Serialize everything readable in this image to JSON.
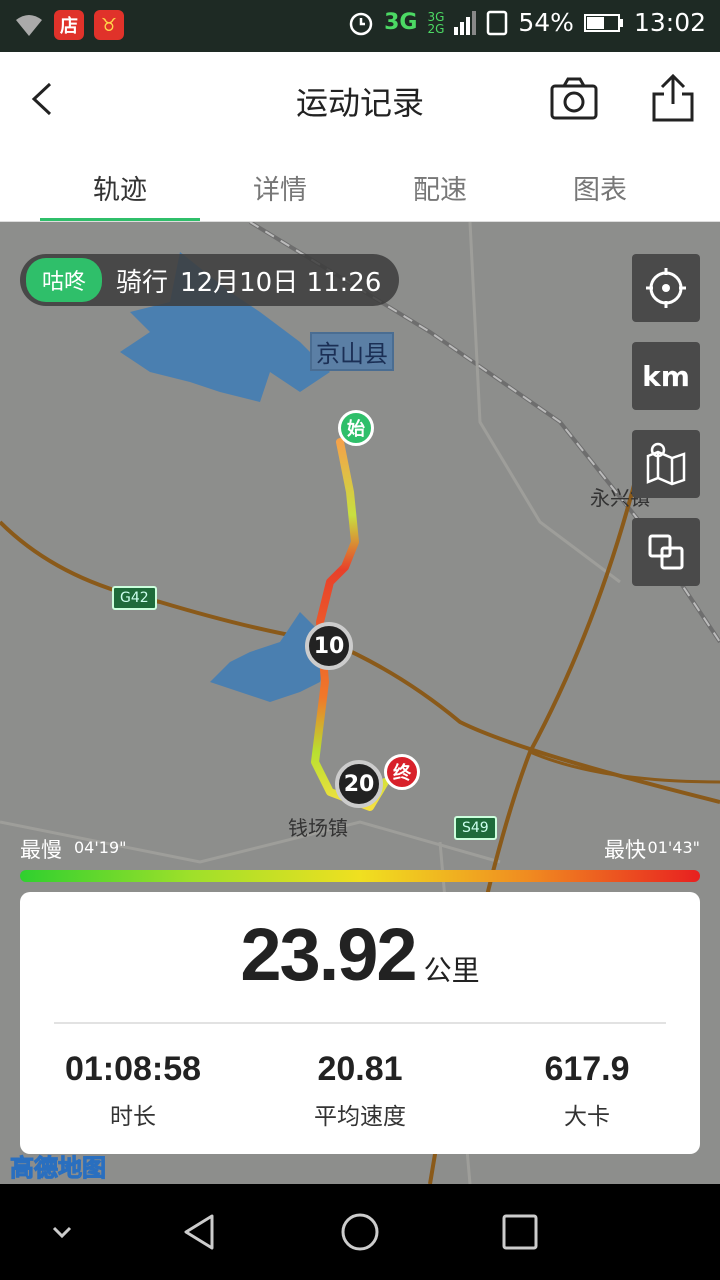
{
  "status_bar": {
    "network_main": "3G",
    "network_sub_top": "3G",
    "network_sub_bottom": "2G",
    "battery": "54%",
    "time": "13:02",
    "icons": [
      "wifi-icon",
      "shop-app-icon",
      "bull-app-icon",
      "alarm-icon",
      "signal-icon",
      "sim-icon",
      "battery-icon"
    ]
  },
  "header": {
    "title": "运动记录",
    "back_icon": "chevron-left-icon",
    "camera_icon": "camera-icon",
    "share_icon": "share-icon"
  },
  "tabs": [
    {
      "label": "轨迹",
      "active": true
    },
    {
      "label": "详情",
      "active": false
    },
    {
      "label": "配速",
      "active": false
    },
    {
      "label": "图表",
      "active": false
    }
  ],
  "map": {
    "tag": "咕咚",
    "sport": "骑行",
    "datetime": "12月10日 11:26",
    "county": "京山县",
    "town_yongxing": "永兴镇",
    "town_qianchang": "钱场镇",
    "road_g42": "G42",
    "road_s49": "S49",
    "start_label": "始",
    "end_label": "终",
    "km_markers": [
      "10",
      "20"
    ],
    "controls": {
      "locate_icon": "crosshair-icon",
      "unit_label": "km",
      "map_icon": "map-icon",
      "layers_icon": "layers-icon"
    },
    "logo": "高德地图",
    "colors": {
      "route_start": "#f4a24a",
      "route_mid": "#e8402a",
      "route_end": "#f4e040",
      "water": "#4a7fb0"
    }
  },
  "speed_scale": {
    "slow_label": "最慢",
    "slow_value": "04'19\"",
    "fast_label": "最快",
    "fast_value": "01'43\""
  },
  "stats": {
    "distance": "23.92",
    "distance_unit": "公里",
    "duration": "01:08:58",
    "duration_label": "时长",
    "avg_speed": "20.81",
    "avg_speed_label": "平均速度",
    "calories": "617.9",
    "calories_label": "大卡"
  },
  "nav_bar": {
    "icons": [
      "collapse-icon",
      "back-triangle-icon",
      "home-circle-icon",
      "recents-square-icon"
    ]
  }
}
